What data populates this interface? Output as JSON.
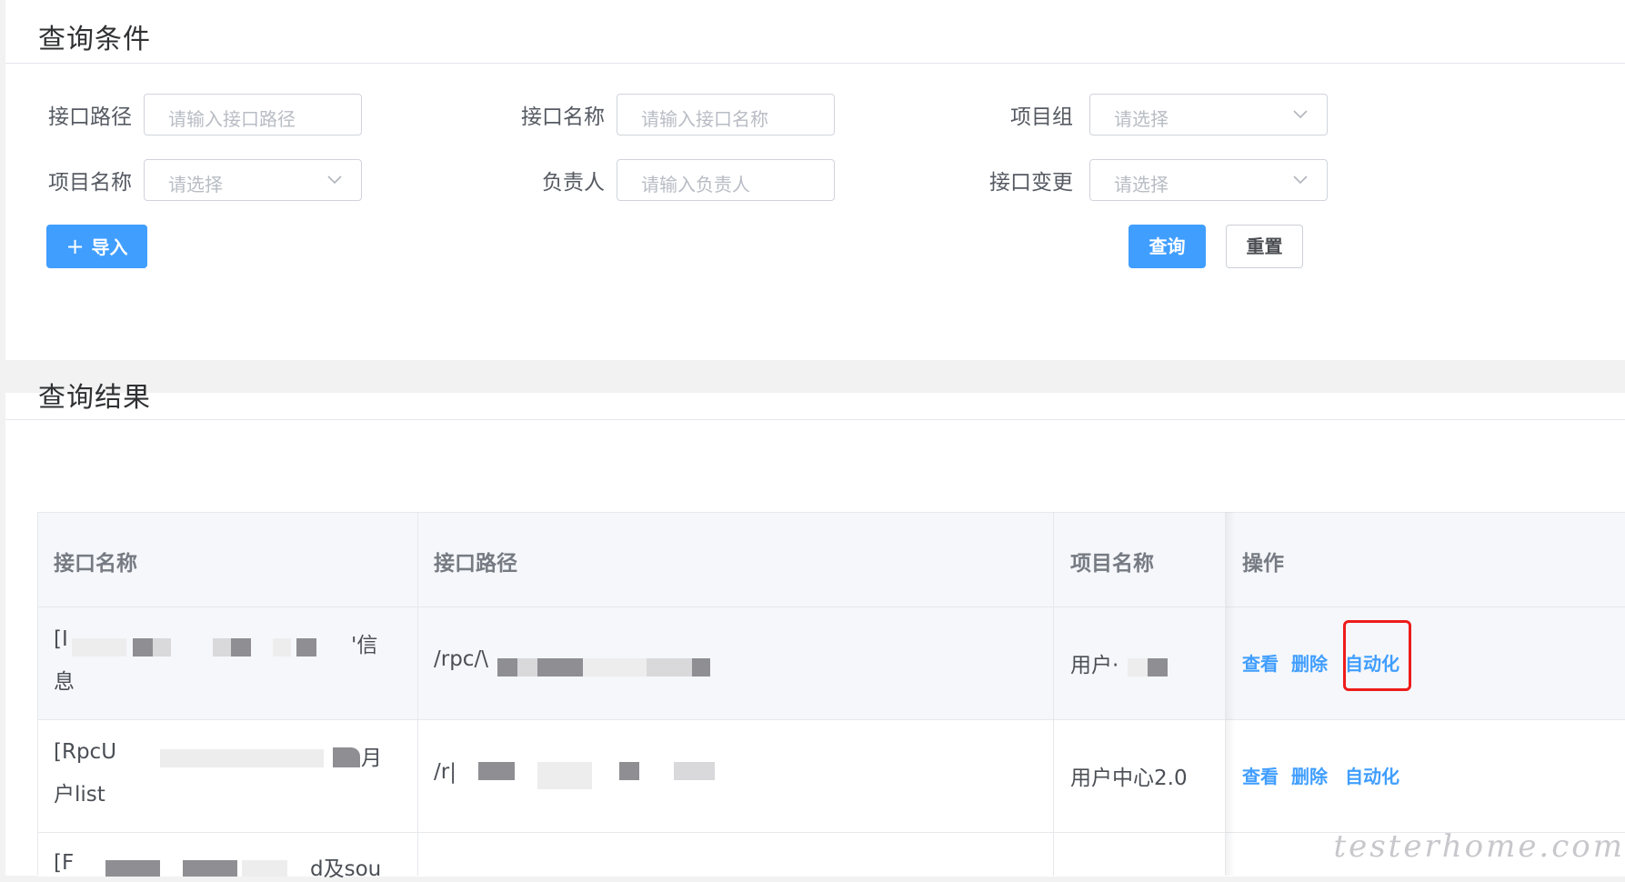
{
  "query_panel": {
    "title": "查询条件",
    "fields": {
      "api_path": {
        "label": "接口路径",
        "placeholder": "请输入接口路径"
      },
      "api_name": {
        "label": "接口名称",
        "placeholder": "请输入接口名称"
      },
      "project_group": {
        "label": "项目组",
        "placeholder": "请选择"
      },
      "project_name": {
        "label": "项目名称",
        "placeholder": "请选择"
      },
      "owner": {
        "label": "负责人",
        "placeholder": "请输入负责人"
      },
      "api_change": {
        "label": "接口变更",
        "placeholder": "请选择"
      }
    },
    "buttons": {
      "import_icon": "+",
      "import": "导入",
      "query": "查询",
      "reset": "重置"
    }
  },
  "result_panel": {
    "title": "查询结果",
    "columns": [
      "接口名称",
      "接口路径",
      "项目名称",
      "操作"
    ],
    "rows": [
      {
        "name_line1_start": "[I",
        "name_line1_end": "'信",
        "name_line2": "息",
        "path": "/rpc/\\",
        "project": "用户·",
        "actions": [
          "查看",
          "删除",
          "自动化"
        ]
      },
      {
        "name_line1_start": "[RpcU",
        "name_line1_end": "月",
        "name_line2": "户list",
        "path": "/r|",
        "project": "用户中心2.0",
        "actions": [
          "查看",
          "删除",
          "自动化"
        ]
      },
      {
        "name_line1_start": "[F",
        "name_line1_end": "d及sou",
        "path": "",
        "project": ""
      }
    ]
  },
  "watermark": "testerhome.com",
  "colors": {
    "primary": "#409eff",
    "highlight": "#ee1c1c"
  }
}
